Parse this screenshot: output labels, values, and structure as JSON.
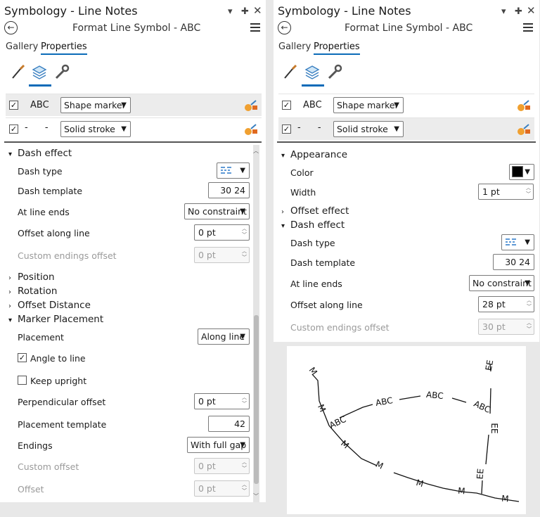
{
  "left": {
    "title": "Symbology - Line Notes",
    "subtitle": "Format Line Symbol - ABC",
    "tabs": [
      "Gallery",
      "Properties"
    ],
    "layers": [
      {
        "name": "ABC",
        "type": "Shape marker"
      },
      {
        "name": "- -",
        "type": "Solid stroke"
      }
    ],
    "dash_effect": {
      "header": "Dash effect",
      "dash_type_label": "Dash type",
      "dash_template_label": "Dash template",
      "dash_template": "30 24",
      "at_line_ends_label": "At line ends",
      "at_line_ends": "No constraint",
      "offset_along_label": "Offset along line",
      "offset_along": "0 pt",
      "custom_endings_label": "Custom endings offset",
      "custom_endings": "0 pt"
    },
    "sections": [
      "Position",
      "Rotation",
      "Offset Distance"
    ],
    "marker_placement": {
      "header": "Marker Placement",
      "placement_label": "Placement",
      "placement": "Along line",
      "angle_to_line": "Angle to line",
      "keep_upright": "Keep upright",
      "perp_offset_label": "Perpendicular offset",
      "perp_offset": "0 pt",
      "template_label": "Placement template",
      "template": "42",
      "endings_label": "Endings",
      "endings": "With full gap",
      "custom_offset_label": "Custom offset",
      "custom_offset": "0 pt",
      "offset_label": "Offset",
      "offset": "0 pt"
    }
  },
  "right": {
    "title": "Symbology - Line Notes",
    "subtitle": "Format Line Symbol - ABC",
    "tabs": [
      "Gallery",
      "Properties"
    ],
    "layers": [
      {
        "name": "ABC",
        "type": "Shape marker"
      },
      {
        "name": "- -",
        "type": "Solid stroke"
      }
    ],
    "appearance": {
      "header": "Appearance",
      "color_label": "Color",
      "color": "#000000",
      "width_label": "Width",
      "width": "1 pt"
    },
    "offset_effect": "Offset effect",
    "dash_effect": {
      "header": "Dash effect",
      "dash_type_label": "Dash type",
      "dash_template_label": "Dash template",
      "dash_template": "30 24",
      "at_line_ends_label": "At line ends",
      "at_line_ends": "No constraint",
      "offset_along_label": "Offset along line",
      "offset_along": "28 pt",
      "custom_endings_label": "Custom endings offset",
      "custom_endings": "30 pt"
    }
  },
  "preview": {
    "labels": [
      "M",
      "M",
      "ABC",
      "ABC",
      "ABC",
      "ABC",
      "M",
      "M",
      "M",
      "M",
      "M",
      "EE",
      "EE",
      "EE"
    ]
  }
}
